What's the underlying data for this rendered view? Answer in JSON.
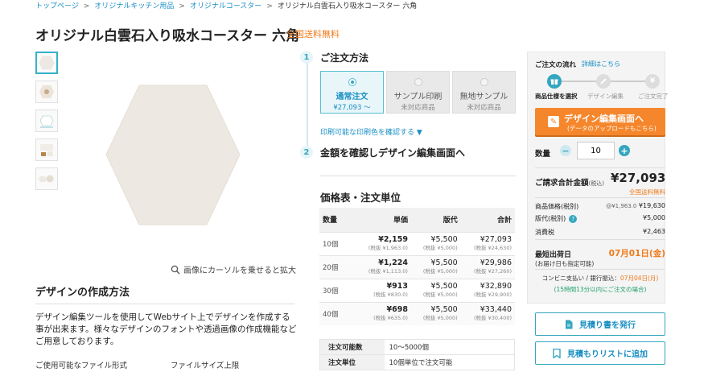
{
  "breadcrumb": {
    "items": [
      "トップページ",
      "オリジナルキッチン用品",
      "オリジナルコースター"
    ],
    "current": "オリジナル白雲石入り吸水コースター 六角",
    "separator": ">"
  },
  "product": {
    "title": "オリジナル白雲石入り吸水コースター 六角",
    "shipping_badge": "全国送料無料",
    "zoom_hint": "画像にカーソルを乗せると拡大"
  },
  "design_section": {
    "heading": "デザインの作成方法",
    "description": "デザイン編集ツールを使用してWebサイト上でデザインを作成する事が出来ます。様々なデザインのフォントや透過画像の作成機能などご用意しております。",
    "file_type_label": "ご使用可能なファイル形式",
    "file_size_label": "ファイルサイズ上限"
  },
  "order": {
    "step1": {
      "number": "1",
      "title": "ご注文方法",
      "options": [
        {
          "label": "通常注文",
          "sub": "¥27,093 〜"
        },
        {
          "label": "サンプル印刷",
          "sub": "未対応商品"
        },
        {
          "label": "無地サンプル",
          "sub": "未対応商品"
        }
      ],
      "print_color_link": "印刷可能な印刷色を確認する ▼"
    },
    "step2": {
      "number": "2",
      "title": "金額を確認しデザイン編集画面へ"
    }
  },
  "price_table": {
    "heading": "価格表・注文単位",
    "headers": [
      "数量",
      "単価",
      "版代",
      "合計"
    ],
    "rows": [
      {
        "qty": "10個",
        "unit": "¥2,159",
        "unit_sub": "(税抜 ¥1,963.0)",
        "plate": "¥5,500",
        "plate_sub": "(税抜 ¥5,000)",
        "total": "¥27,093",
        "total_sub": "(税抜 ¥24,630)"
      },
      {
        "qty": "20個",
        "unit": "¥1,224",
        "unit_sub": "(税抜 ¥1,113.0)",
        "plate": "¥5,500",
        "plate_sub": "(税抜 ¥5,000)",
        "total": "¥29,986",
        "total_sub": "(税抜 ¥27,260)"
      },
      {
        "qty": "30個",
        "unit": "¥913",
        "unit_sub": "(税抜 ¥830.0)",
        "plate": "¥5,500",
        "plate_sub": "(税抜 ¥5,000)",
        "total": "¥32,890",
        "total_sub": "(税抜 ¥29,900)"
      },
      {
        "qty": "40個",
        "unit": "¥698",
        "unit_sub": "(税抜 ¥635.0)",
        "plate": "¥5,500",
        "plate_sub": "(税抜 ¥5,000)",
        "total": "¥33,440",
        "total_sub": "(税抜 ¥30,400)"
      }
    ]
  },
  "order_info": {
    "rows": [
      {
        "key": "注文可能数",
        "value": "10〜5000個"
      },
      {
        "key": "注文単位",
        "value": "10個単位で注文可能"
      }
    ]
  },
  "panel": {
    "flow_heading": "ご注文の流れ",
    "flow_link": "詳細はこちら",
    "flow_steps": [
      "商品仕様を選択",
      "デザイン編集",
      "ご注文完了"
    ],
    "design_button": "デザイン編集画面へ",
    "design_button_sub": "(データのアップロードもこちら)",
    "qty_label": "数量",
    "qty_value": "10",
    "total_label": "ご請求合計金額",
    "total_tax": "(税込)",
    "total_value": "¥27,093",
    "total_shipping": "全国送料無料",
    "breakdown": [
      {
        "label": "商品価格(税別)",
        "value_sub": "@¥1,963.0",
        "value": "¥19,630"
      },
      {
        "label": "版代(税別)",
        "value": "¥5,000"
      },
      {
        "label": "消費税",
        "value": "¥2,463"
      }
    ],
    "ship_label": "最短出荷日",
    "ship_date": "07月01日(金)",
    "ship_sub": "(お届け日も指定可能)",
    "konbini_prefix": "コンビニ支払い / 銀行振込：",
    "konbini_date": "07月04日(月)",
    "konbini_sub": "(15時間13分以内にご注文の場合)",
    "quote_button": "見積り書を発行",
    "list_button": "見積もりリストに追加"
  },
  "colors": {
    "accent": "#35a6bf",
    "link": "#1a8fc4",
    "orange": "#f5862b",
    "green": "#1fa06b",
    "coaster": "#ede8e1"
  },
  "icons": [
    "search-icon",
    "document-icon",
    "bookmark-icon",
    "gift-icon",
    "pencil-icon",
    "yen-icon",
    "edit-icon",
    "chevron-down-icon"
  ]
}
